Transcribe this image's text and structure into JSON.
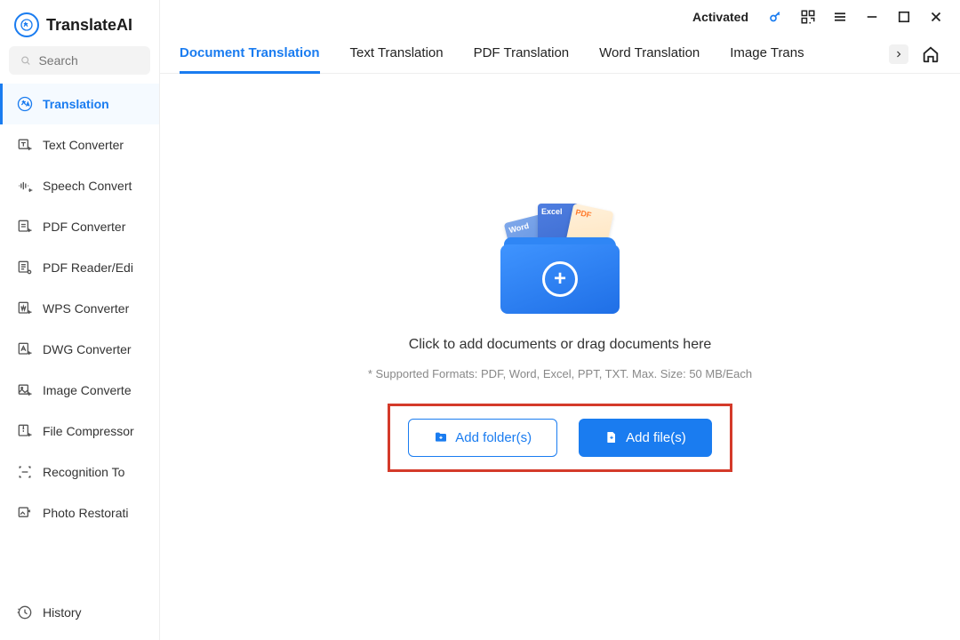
{
  "app": {
    "name": "TranslateAI"
  },
  "search": {
    "placeholder": "Search"
  },
  "sidebar": {
    "items": [
      {
        "label": "Translation"
      },
      {
        "label": "Text Converter"
      },
      {
        "label": "Speech Convert"
      },
      {
        "label": "PDF Converter"
      },
      {
        "label": "PDF Reader/Edi"
      },
      {
        "label": "WPS Converter"
      },
      {
        "label": "DWG Converter"
      },
      {
        "label": "Image Converte"
      },
      {
        "label": "File Compressor"
      },
      {
        "label": "Recognition To"
      },
      {
        "label": "Photo Restorati"
      }
    ],
    "history": {
      "label": "History"
    }
  },
  "titlebar": {
    "activated": "Activated"
  },
  "tabs": [
    {
      "label": "Document Translation"
    },
    {
      "label": "Text Translation"
    },
    {
      "label": "PDF Translation"
    },
    {
      "label": "Word Translation"
    },
    {
      "label": "Image Trans"
    }
  ],
  "dropzone": {
    "doc_labels": {
      "word": "Word",
      "excel": "Excel",
      "pdf": "PDF"
    },
    "hint": "Click to add documents or drag documents here",
    "sub_hint": "* Supported Formats: PDF, Word, Excel, PPT, TXT. Max. Size: 50 MB/Each",
    "add_folder": "Add folder(s)",
    "add_file": "Add file(s)"
  },
  "colors": {
    "accent": "#1a7cf0",
    "highlight_border": "#d43a2a"
  }
}
